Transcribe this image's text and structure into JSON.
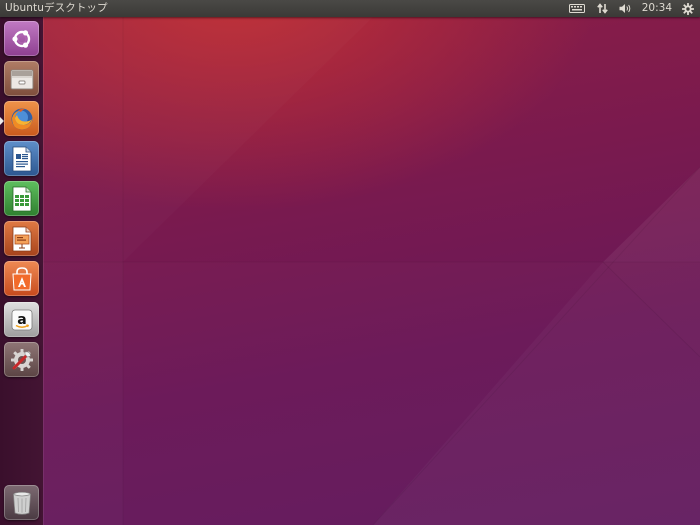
{
  "panel": {
    "title": "Ubuntuデスクトップ",
    "clock": "20:34"
  },
  "indicators": [
    {
      "icon": "keyboard-icon"
    },
    {
      "icon": "network-icon"
    },
    {
      "icon": "volume-icon"
    },
    {
      "icon": "clock"
    },
    {
      "icon": "gear-icon"
    }
  ],
  "launcher": {
    "items": [
      {
        "name": "dash-home",
        "icon": "ubuntu-logo-icon",
        "color": "#a55aa7"
      },
      {
        "name": "files",
        "icon": "file-cabinet-icon",
        "color": "#9a6a55"
      },
      {
        "name": "firefox",
        "icon": "firefox-icon",
        "color": "#e2762b",
        "running": true
      },
      {
        "name": "writer",
        "icon": "libreoffice-writer-icon",
        "color": "#3c6ca8"
      },
      {
        "name": "calc",
        "icon": "libreoffice-calc-icon",
        "color": "#3a9a3a"
      },
      {
        "name": "impress",
        "icon": "libreoffice-impress-icon",
        "color": "#c2572a"
      },
      {
        "name": "software-center",
        "icon": "shopping-bag-icon",
        "color": "#e9612c"
      },
      {
        "name": "amazon",
        "icon": "amazon-icon",
        "color": "#c9c9c9"
      },
      {
        "name": "system-settings",
        "icon": "settings-tools-icon",
        "color": "#7d6262"
      },
      {
        "name": "trash",
        "icon": "trash-icon",
        "color": "#6a5a62"
      }
    ]
  },
  "colors": {
    "panel_bg": "#3c3b37",
    "panel_text": "#dfdbd2",
    "launcher_bg": "#3e1130",
    "wallpaper_top": "#c4302f",
    "wallpaper_bottom": "#621a5e"
  }
}
